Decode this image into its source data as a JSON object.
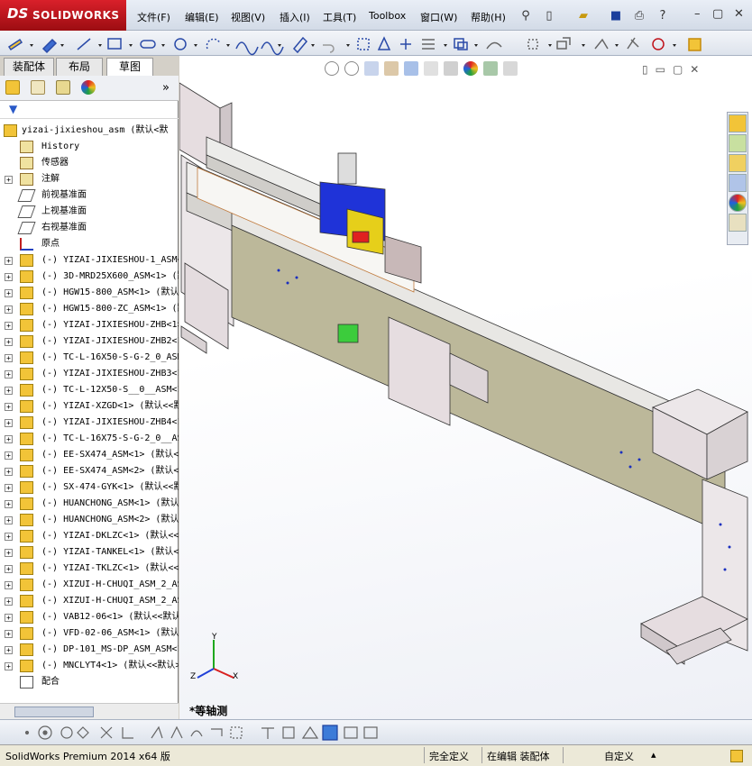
{
  "app": {
    "brand_ds": "DS",
    "brand_name": "SOLIDWORKS"
  },
  "menu": [
    {
      "label": "文件(F)"
    },
    {
      "label": "编辑(E)"
    },
    {
      "label": "视图(V)"
    },
    {
      "label": "插入(I)"
    },
    {
      "label": "工具(T)"
    },
    {
      "label": "Toolbox"
    },
    {
      "label": "窗口(W)"
    },
    {
      "label": "帮助(H)"
    }
  ],
  "tabs": [
    "装配体",
    "布局",
    "草图"
  ],
  "tree": {
    "root": "yizai-jixieshou_asm  (默认<默",
    "special": [
      {
        "label": "History",
        "icon": "history-icon"
      },
      {
        "label": "传感器",
        "icon": "sensor-icon"
      },
      {
        "label": "注解",
        "icon": "annotation-icon"
      },
      {
        "label": "前视基准面",
        "icon": "plane-icon"
      },
      {
        "label": "上视基准面",
        "icon": "plane-icon"
      },
      {
        "label": "右视基准面",
        "icon": "plane-icon"
      },
      {
        "label": "原点",
        "icon": "origin-icon"
      }
    ],
    "components": [
      "(-) YIZAI-JIXIESHOU-1_ASM<1>",
      "(-) 3D-MRD25X600_ASM<1>  (默",
      "(-) HGW15-800_ASM<1>  (默认<",
      "(-) HGW15-800-ZC_ASM<1>  (默",
      "(-) YIZAI-JIXIESHOU-ZHB<1>",
      "(-) YIZAI-JIXIESHOU-ZHB2<1>",
      "(-) TC-L-16X50-S-G-2_0_ASM",
      "(-) YIZAI-JIXIESHOU-ZHB3<1>",
      "(-) TC-L-12X50-S__0__ASM<1>",
      "(-) YIZAI-XZGD<1>  (默认<<默",
      "(-) YIZAI-JIXIESHOU-ZHB4<1>",
      "(-) TC-L-16X75-S-G-2_0__ASM",
      "(-) EE-SX474_ASM<1>  (默认<",
      "(-) EE-SX474_ASM<2>  (默认<",
      "(-) SX-474-GYK<1>  (默认<<默",
      "(-) HUANCHONG_ASM<1>  (默认<",
      "(-) HUANCHONG_ASM<2>  (默认<",
      "(-) YIZAI-DKLZC<1>  (默认<<",
      "(-) YIZAI-TANKEL<1>  (默认<",
      "(-) YIZAI-TKLZC<1>  (默认<<",
      "(-) XIZUI-H-CHUQI_ASM_2_ASM",
      "(-) XIZUI-H-CHUQI_ASM_2_ASM",
      "(-) VAB12-06<1>  (默认<<默认",
      "(-) VFD-02-06_ASM<1>  (默认",
      "(-) DP-101_MS-DP_ASM_ASM<1>",
      "(-) MNCLYT4<1>  (默认<<默认>"
    ],
    "mates": "配合"
  },
  "viewport": {
    "view_label": "*等轴测",
    "triad": {
      "x": "X",
      "y": "Y",
      "z": "Z"
    }
  },
  "status": {
    "product": "SolidWorks Premium 2014 x64 版",
    "defined": "完全定义",
    "editing": "在编辑 装配体",
    "custom": "自定义"
  },
  "colors": {
    "accent": "#c0121a",
    "model_gray": "#d8d6d2",
    "model_olive": "#bcb89a",
    "bracket": "#e6dde0",
    "motor_blue": "#1f33d8",
    "motor_yellow": "#e6cf1a"
  }
}
